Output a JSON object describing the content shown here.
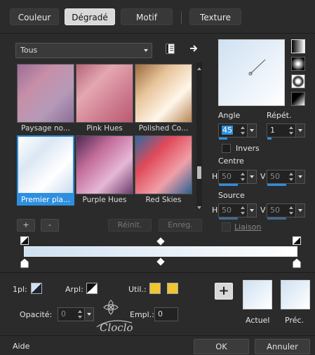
{
  "tabs": [
    {
      "label": "Couleur"
    },
    {
      "label": "Dégradé"
    },
    {
      "label": "Motif"
    },
    {
      "label": "Texture"
    }
  ],
  "category_select": {
    "value": "Tous"
  },
  "swatches": [
    {
      "label": "Paysage no...",
      "colors": [
        "#9b6f97",
        "#c78fa8",
        "#b59ab8",
        "#8a6f9a"
      ]
    },
    {
      "label": "Pink Hues",
      "colors": [
        "#b8667a",
        "#e3a7b1",
        "#cf7d90",
        "#b95a73"
      ]
    },
    {
      "label": "Polished Co...",
      "colors": [
        "#9b6b3e",
        "#e8c49a",
        "#fff6ea",
        "#b98554"
      ]
    },
    {
      "label": "Premier pla...",
      "colors": [
        "#ffffff",
        "#dbe7f3",
        "#ffffff",
        "#c9dbee"
      ],
      "selected": true
    },
    {
      "label": "Purple Hues",
      "colors": [
        "#4b2b52",
        "#c36c9a",
        "#e6b7d6",
        "#6d3d6e"
      ]
    },
    {
      "label": "Red Skies",
      "colors": [
        "#2d6aa3",
        "#e04a5a",
        "#f0a0a8",
        "#2a5f93"
      ]
    }
  ],
  "buttons": {
    "add": "+",
    "remove": "-",
    "reset": "Réinit.",
    "save": "Enreg.",
    "add_to_palette": "+",
    "ok": "OK",
    "cancel": "Annuler",
    "help": "Aide"
  },
  "angle": {
    "label": "Angle",
    "value": "45"
  },
  "repeat": {
    "label": "Répét.",
    "value": "1"
  },
  "invert": {
    "label": "Invers",
    "checked": false
  },
  "center": {
    "label": "Centre",
    "h_label": "H",
    "h_value": "50",
    "v_label": "V",
    "v_value": "50"
  },
  "source": {
    "label": "Source",
    "h_label": "H",
    "h_value": "50",
    "v_label": "V",
    "v_value": "50"
  },
  "link": {
    "label": "Liaison"
  },
  "gradient_bar": {
    "start_color": "#cfe1f2",
    "end_color": "#ffffff"
  },
  "bottom": {
    "first_plan_label": "1pl:",
    "background_label": "Arpl:",
    "util_label": "Util.:",
    "util_color": "#f1c430",
    "opacity_label": "Opacité:",
    "opacity_value": "0",
    "empl_label": "Empl.:",
    "empl_value": "0",
    "current_label": "Actuel",
    "previous_label": "Préc."
  },
  "watermark": {
    "text": "Cloclo"
  },
  "colors": {
    "accent": "#2e8fe0",
    "bg": "#2b2b2b"
  }
}
